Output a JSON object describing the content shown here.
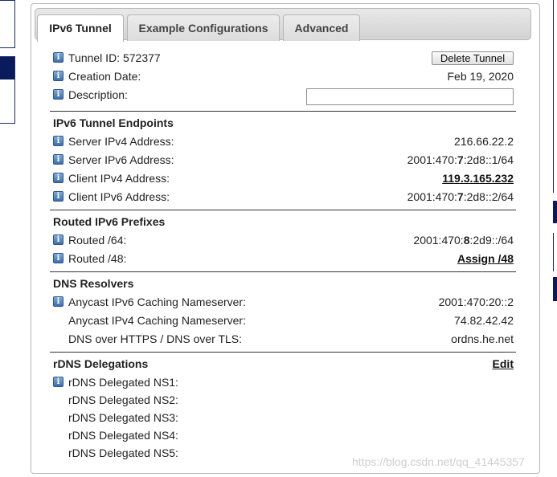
{
  "tabs": [
    {
      "label": "IPv6 Tunnel",
      "active": true
    },
    {
      "label": "Example Configurations",
      "active": false
    },
    {
      "label": "Advanced",
      "active": false
    }
  ],
  "tunnel": {
    "tunnel_id_label": "Tunnel ID: 572377",
    "delete_button": "Delete Tunnel",
    "creation_date_label": "Creation Date:",
    "creation_date_value": "Feb 19, 2020",
    "description_label": "Description:",
    "description_value": ""
  },
  "endpoints": {
    "title": "IPv6 Tunnel Endpoints",
    "server_ipv4_label": "Server IPv4 Address:",
    "server_ipv4_value": "216.66.22.2",
    "server_ipv6_label": "Server IPv6 Address:",
    "server_ipv6_pre": "2001:470:",
    "server_ipv6_bold": "7",
    "server_ipv6_post": ":2d8::1/64",
    "client_ipv4_label": "Client IPv4 Address:",
    "client_ipv4_value": "119.3.165.232",
    "client_ipv6_label": "Client IPv6 Address:",
    "client_ipv6_pre": "2001:470:",
    "client_ipv6_bold": "7",
    "client_ipv6_post": ":2d8::2/64"
  },
  "routed": {
    "title": "Routed IPv6 Prefixes",
    "r64_label": "Routed /64:",
    "r64_pre": "2001:470:",
    "r64_bold": "8",
    "r64_post": ":2d9::/64",
    "r48_label": "Routed /48:",
    "r48_link": "Assign /48"
  },
  "dns": {
    "title": "DNS Resolvers",
    "anycast_ipv6_label": "Anycast IPv6 Caching Nameserver:",
    "anycast_ipv6_value": "2001:470:20::2",
    "anycast_ipv4_label": "Anycast IPv4 Caching Nameserver:",
    "anycast_ipv4_value": "74.82.42.42",
    "doh_label": "DNS over HTTPS / DNS over TLS:",
    "doh_value": "ordns.he.net"
  },
  "rdns": {
    "title": "rDNS Delegations",
    "edit_link": "Edit",
    "ns1": "rDNS Delegated NS1:",
    "ns2": "rDNS Delegated NS2:",
    "ns3": "rDNS Delegated NS3:",
    "ns4": "rDNS Delegated NS4:",
    "ns5": "rDNS Delegated NS5:"
  },
  "watermark": "https://blog.csdn.net/qq_41445357",
  "icons": {
    "info": "info-icon"
  },
  "colors": {
    "nav_dark": "#0a1b5c",
    "info_icon": "#3c6fb0"
  }
}
